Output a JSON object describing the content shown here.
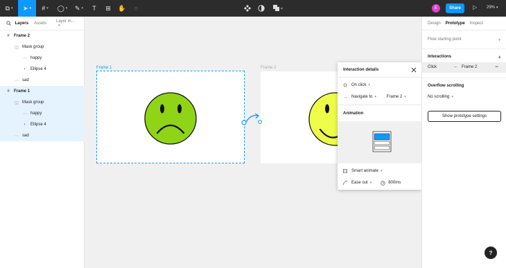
{
  "toolbar": {
    "tools": [
      {
        "icon": "main-menu-icon",
        "glyph": "⧉"
      },
      {
        "icon": "move-tool-icon",
        "glyph": "➤"
      },
      {
        "icon": "frame-tool-icon",
        "glyph": "#"
      },
      {
        "icon": "shape-tool-icon",
        "glyph": "◯"
      },
      {
        "icon": "pen-tool-icon",
        "glyph": "✎"
      },
      {
        "icon": "text-tool-icon",
        "glyph": "T"
      },
      {
        "icon": "resources-icon",
        "glyph": "⊞"
      },
      {
        "icon": "hand-tool-icon",
        "glyph": "✋"
      },
      {
        "icon": "comment-tool-icon",
        "glyph": "◌"
      }
    ],
    "center_icons": [
      "component-icon",
      "contrast-icon",
      "boolean-icon"
    ],
    "avatar_initial": "E",
    "share_label": "Share",
    "zoom": "29%"
  },
  "left_panel": {
    "tabs": [
      "Layers",
      "Assets",
      "Layer m..."
    ],
    "layers": [
      {
        "label": "Frame 2",
        "icon": "frame-icon",
        "glyph": "#",
        "indent": 0,
        "bold": true,
        "selected": false
      },
      {
        "label": "Mask group",
        "icon": "mask-group-icon",
        "glyph": "◫",
        "indent": 1,
        "bold": false,
        "selected": false
      },
      {
        "label": "happy",
        "icon": "vector-icon",
        "glyph": "⋯",
        "indent": 2,
        "bold": false,
        "selected": false
      },
      {
        "label": "Ellipse 4",
        "icon": "ellipse-icon",
        "glyph": "◐",
        "indent": 2,
        "bold": false,
        "selected": false
      },
      {
        "label": "sad",
        "icon": "vector-icon",
        "glyph": "⋯",
        "indent": 1,
        "bold": false,
        "selected": false
      },
      {
        "label": "Frame 1",
        "icon": "frame-icon",
        "glyph": "#",
        "indent": 0,
        "bold": true,
        "selected": true
      },
      {
        "label": "Mask group",
        "icon": "mask-group-icon",
        "glyph": "◫",
        "indent": 1,
        "bold": false,
        "selected": true
      },
      {
        "label": "happy",
        "icon": "vector-icon",
        "glyph": "⋯",
        "indent": 2,
        "bold": false,
        "selected": true
      },
      {
        "label": "Ellipse 4",
        "icon": "ellipse-icon",
        "glyph": "◐",
        "indent": 2,
        "bold": false,
        "selected": true
      },
      {
        "label": "sad",
        "icon": "vector-icon",
        "glyph": "⋯",
        "indent": 1,
        "bold": false,
        "selected": true
      }
    ]
  },
  "canvas": {
    "frame1_label": "Frame 1",
    "frame2_label": "Frame 2",
    "selection_color": "#0d99ff",
    "sad_face_color": "#8fd416",
    "happy_face_color": "#eefc4a"
  },
  "popup": {
    "title": "Interaction details",
    "trigger": "On click",
    "action": "Navigate to",
    "destination": "Frame 2",
    "animation_heading": "Animation",
    "animation_type": "Smart animate",
    "easing": "Ease out",
    "duration": "800ms"
  },
  "right_panel": {
    "tabs": [
      "Design",
      "Prototype",
      "Inspect"
    ],
    "flow_label": "Flow starting point",
    "interactions_heading": "Interactions",
    "interaction_trigger": "Click",
    "interaction_target": "Frame 2",
    "overflow_heading": "Overflow scrolling",
    "overflow_value": "No scrolling",
    "settings_button": "Show prototype settings"
  },
  "help_label": "?"
}
